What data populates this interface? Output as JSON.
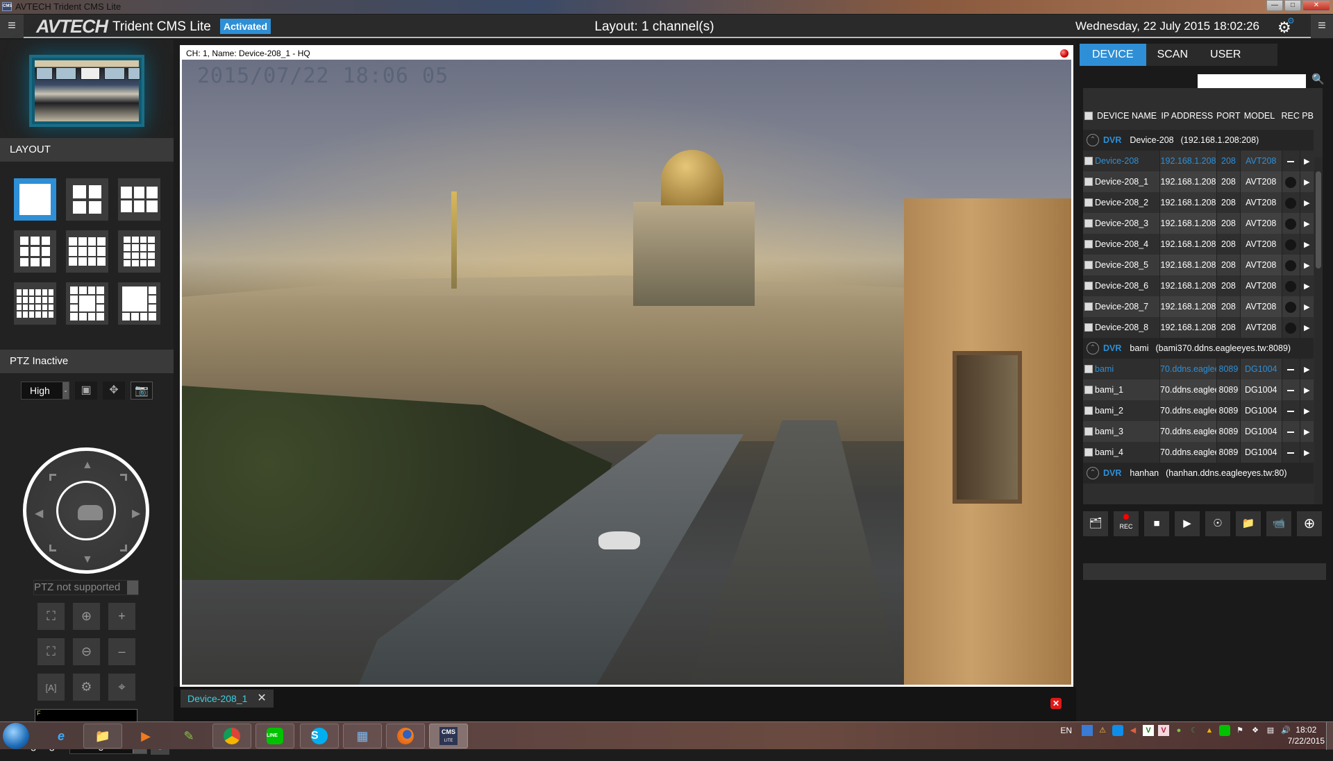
{
  "window": {
    "title": "AVTECH Trident CMS Lite",
    "app_icon_text": "CMS",
    "controls": [
      "minimize",
      "maximize",
      "close"
    ]
  },
  "header": {
    "logo": "AVTECH",
    "product": "Trident CMS Lite",
    "license_badge": "Activated",
    "layout_title": "Layout: 1 channel(s)",
    "datetime": "Wednesday, 22 July 2015 18:02:26",
    "accent_color": "#2e8fd6"
  },
  "left_panel": {
    "layout_heading": "LAYOUT",
    "layouts": [
      {
        "name": "1-channel",
        "active": true
      },
      {
        "name": "4-channel",
        "active": false
      },
      {
        "name": "6-channel",
        "active": false
      },
      {
        "name": "9-channel",
        "active": false
      },
      {
        "name": "12-channel",
        "active": false
      },
      {
        "name": "16-channel",
        "active": false
      },
      {
        "name": "24-channel",
        "active": false
      },
      {
        "name": "13-channel-center",
        "active": false
      },
      {
        "name": "8-channel-corner",
        "active": false
      }
    ],
    "ptz_heading": "PTZ Inactive",
    "stream_quality": "High",
    "ptz_preset": "PTZ not supported",
    "preset_field_value": "F",
    "language_label": "Language:",
    "language_value": "English"
  },
  "video": {
    "channel_label": "CH: 1, Name: Device-208_1 - HQ",
    "osd_timestamp": "2015/07/22 18:06 05"
  },
  "tab_bar": {
    "open_tabs": [
      {
        "label": "Device-208_1"
      }
    ]
  },
  "right_panel": {
    "tabs": [
      {
        "label": "DEVICE",
        "active": true
      },
      {
        "label": "SCAN",
        "active": false
      },
      {
        "label": "USER",
        "active": false
      }
    ],
    "search_value": "",
    "columns": [
      "DEVICE NAME",
      "IP ADDRESS",
      "PORT",
      "MODEL",
      "REC",
      "PB"
    ],
    "groups": [
      {
        "type": "DVR",
        "name": "Device-208",
        "address": "(192.168.1.208:208)",
        "rows": [
          {
            "name": "Device-208",
            "ip": "192.168.1.208",
            "port": "208",
            "model": "AVT208",
            "rec": "dash",
            "selected": true
          },
          {
            "name": "Device-208_1",
            "ip": "192.168.1.208",
            "port": "208",
            "model": "AVT208",
            "rec": "dot",
            "selected": false
          },
          {
            "name": "Device-208_2",
            "ip": "192.168.1.208",
            "port": "208",
            "model": "AVT208",
            "rec": "dot",
            "selected": false
          },
          {
            "name": "Device-208_3",
            "ip": "192.168.1.208",
            "port": "208",
            "model": "AVT208",
            "rec": "dot",
            "selected": false
          },
          {
            "name": "Device-208_4",
            "ip": "192.168.1.208",
            "port": "208",
            "model": "AVT208",
            "rec": "dot",
            "selected": false
          },
          {
            "name": "Device-208_5",
            "ip": "192.168.1.208",
            "port": "208",
            "model": "AVT208",
            "rec": "dot",
            "selected": false
          },
          {
            "name": "Device-208_6",
            "ip": "192.168.1.208",
            "port": "208",
            "model": "AVT208",
            "rec": "dot",
            "selected": false
          },
          {
            "name": "Device-208_7",
            "ip": "192.168.1.208",
            "port": "208",
            "model": "AVT208",
            "rec": "dot",
            "selected": false
          },
          {
            "name": "Device-208_8",
            "ip": "192.168.1.208",
            "port": "208",
            "model": "AVT208",
            "rec": "dot",
            "selected": false
          }
        ]
      },
      {
        "type": "DVR",
        "name": "bami",
        "address": "(bami370.ddns.eagleeyes.tw:8089)",
        "rows": [
          {
            "name": "bami",
            "ip": "70.ddns.eaglee",
            "port": "8089",
            "model": "DG1004",
            "rec": "dash",
            "selected": true
          },
          {
            "name": "bami_1",
            "ip": "70.ddns.eaglee",
            "port": "8089",
            "model": "DG1004",
            "rec": "dash",
            "selected": false
          },
          {
            "name": "bami_2",
            "ip": "70.ddns.eaglee",
            "port": "8089",
            "model": "DG1004",
            "rec": "dash",
            "selected": false
          },
          {
            "name": "bami_3",
            "ip": "70.ddns.eaglee",
            "port": "8089",
            "model": "DG1004",
            "rec": "dash",
            "selected": false
          },
          {
            "name": "bami_4",
            "ip": "70.ddns.eaglee",
            "port": "8089",
            "model": "DG1004",
            "rec": "dash",
            "selected": false
          }
        ]
      },
      {
        "type": "DVR",
        "name": "hanhan",
        "address": "(hanhan.ddns.eagleeyes.tw:80)",
        "rows": []
      }
    ],
    "actions": [
      {
        "name": "record-snapshot",
        "label": ""
      },
      {
        "name": "record",
        "label": "REC"
      },
      {
        "name": "stop",
        "label": ""
      },
      {
        "name": "playback-disk",
        "label": ""
      },
      {
        "name": "backup",
        "label": ""
      },
      {
        "name": "add-folder",
        "label": ""
      },
      {
        "name": "add-camera",
        "label": ""
      },
      {
        "name": "add-device",
        "label": ""
      }
    ]
  },
  "taskbar": {
    "apps": [
      "internet-explorer",
      "file-explorer",
      "media-player",
      "paint",
      "chrome",
      "line",
      "skype",
      "control-panel",
      "firefox",
      "cms-lite"
    ],
    "cms_icon_text": "CMS",
    "cms_icon_subtext": "LITE",
    "language": "EN",
    "time": "18:02",
    "date": "7/22/2015"
  }
}
